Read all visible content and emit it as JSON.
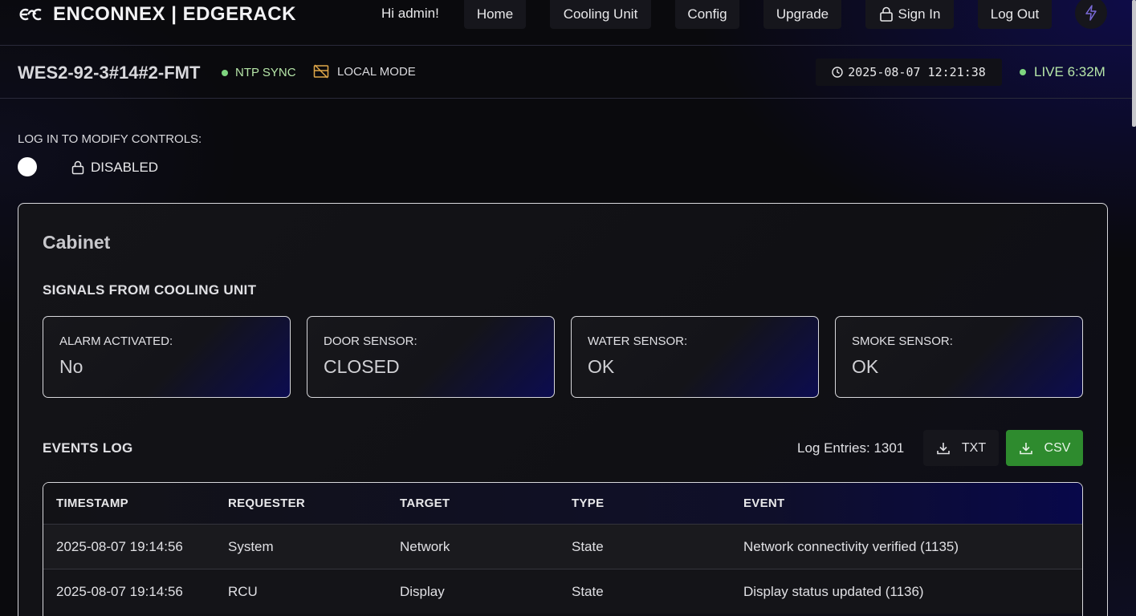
{
  "brand": {
    "name": "ENCONNEX | EDGERACK",
    "logo_icon": "enconnex-logo-icon"
  },
  "nav": {
    "greeting": "Hi admin!",
    "home": "Home",
    "cooling_unit": "Cooling Unit",
    "config": "Config",
    "upgrade": "Upgrade",
    "sign_in": "Sign In",
    "log_out": "Log Out",
    "bolt_icon": "bolt-icon"
  },
  "status": {
    "device_name": "WES2-92-3#14#2-FMT",
    "ntp": "NTP SYNC",
    "local_mode": "LOCAL MODE",
    "datetime": "2025-08-07 12:21:38",
    "live": "LIVE 6:32M",
    "status_color": "#7ed57f"
  },
  "controls": {
    "login_label": "LOG IN TO MODIFY CONTROLS:",
    "toggle_state": "DISABLED"
  },
  "cabinet": {
    "title": "Cabinet",
    "signals_title": "SIGNALS FROM COOLING UNIT",
    "signals": [
      {
        "label": "ALARM ACTIVATED:",
        "value": "No"
      },
      {
        "label": "DOOR SENSOR:",
        "value": "CLOSED"
      },
      {
        "label": "WATER SENSOR:",
        "value": "OK"
      },
      {
        "label": "SMOKE SENSOR:",
        "value": "OK"
      }
    ],
    "events_title": "EVENTS LOG",
    "log_entries": "Log Entries: 1301",
    "txt_button": "TXT",
    "csv_button": "CSV",
    "csv_color": "#2e8b2e",
    "columns": [
      "TIMESTAMP",
      "REQUESTER",
      "TARGET",
      "TYPE",
      "EVENT"
    ],
    "rows": [
      [
        "2025-08-07 19:14:56",
        "System",
        "Network",
        "State",
        "Network connectivity verified (1135)"
      ],
      [
        "2025-08-07 19:14:56",
        "RCU",
        "Display",
        "State",
        "Display status updated (1136)"
      ]
    ]
  }
}
